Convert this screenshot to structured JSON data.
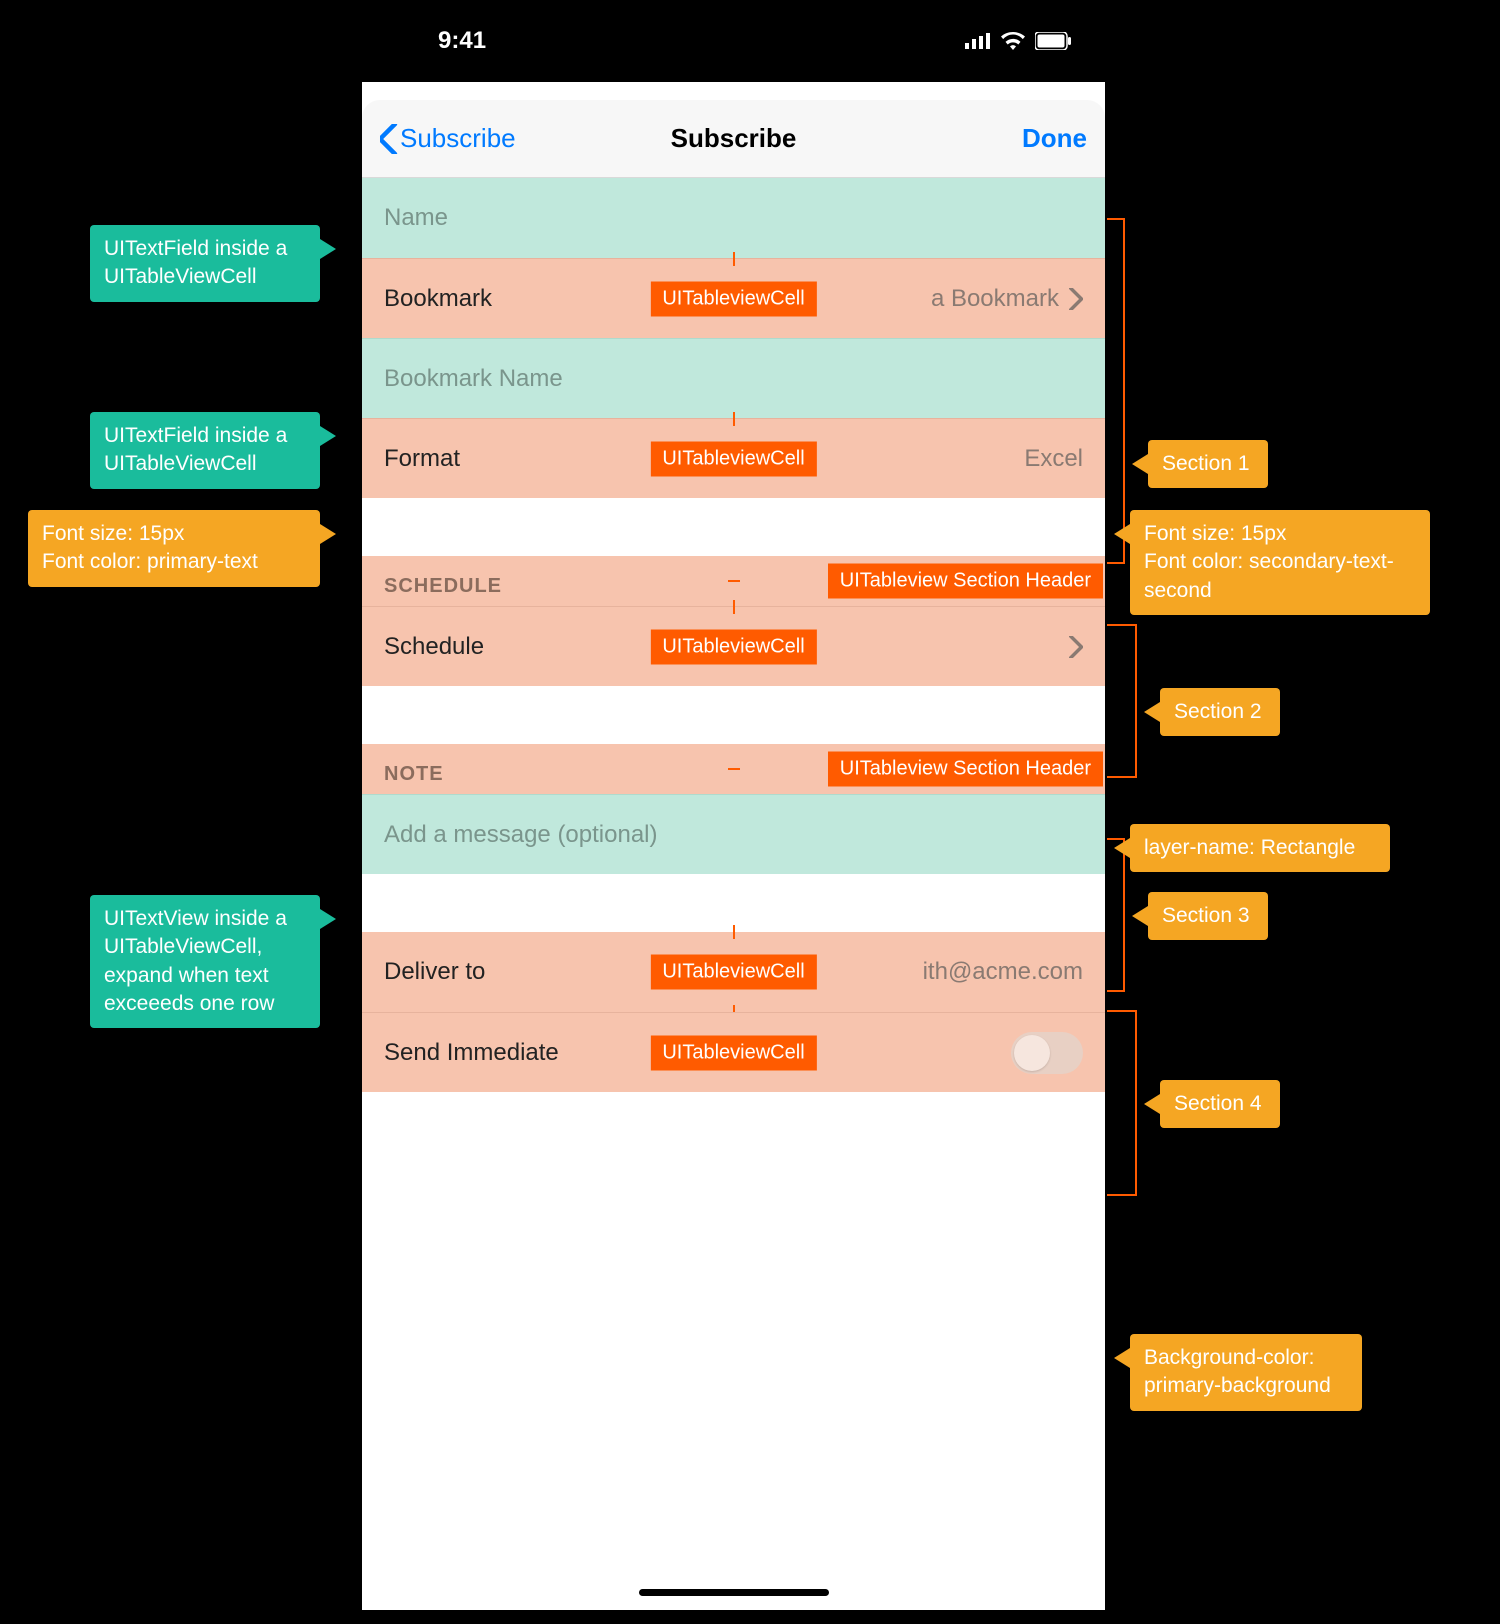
{
  "statusbar": {
    "time": "9:41"
  },
  "nav": {
    "back_label": "Subscribe",
    "title": "Subscribe",
    "done_label": "Done"
  },
  "section1": {
    "name_placeholder": "Name",
    "bookmark_label": "Bookmark",
    "bookmark_value": "a Bookmark",
    "bookmark_name_placeholder": "Bookmark Name",
    "format_label": "Format",
    "format_value": "Excel"
  },
  "section2": {
    "header": "SCHEDULE",
    "schedule_label": "Schedule"
  },
  "section3": {
    "header": "NOTE",
    "message_placeholder": "Add a message (optional)"
  },
  "section4": {
    "deliver_label": "Deliver to",
    "deliver_value": "ith@acme.com",
    "send_label": "Send Immediate"
  },
  "badges": {
    "cell": "UITableviewCell",
    "header": "UITableview Section Header"
  },
  "annotations": {
    "textfield_cell": "UITextField inside a UITableViewCell",
    "font_primary": "Font size: 15px\nFont color: primary-text",
    "font_secondary": "Font size: 15px\nFont color: secondary-text-second",
    "textview_cell": "UITextView inside a UITableViewCell, expand when text exceeeds one row",
    "section1": "Section 1",
    "section2": "Section 2",
    "section3": "Section 3",
    "section4": "Section 4",
    "layer_rect": "layer-name: Rectangle",
    "bg_primary": "Background-color: primary-background"
  }
}
